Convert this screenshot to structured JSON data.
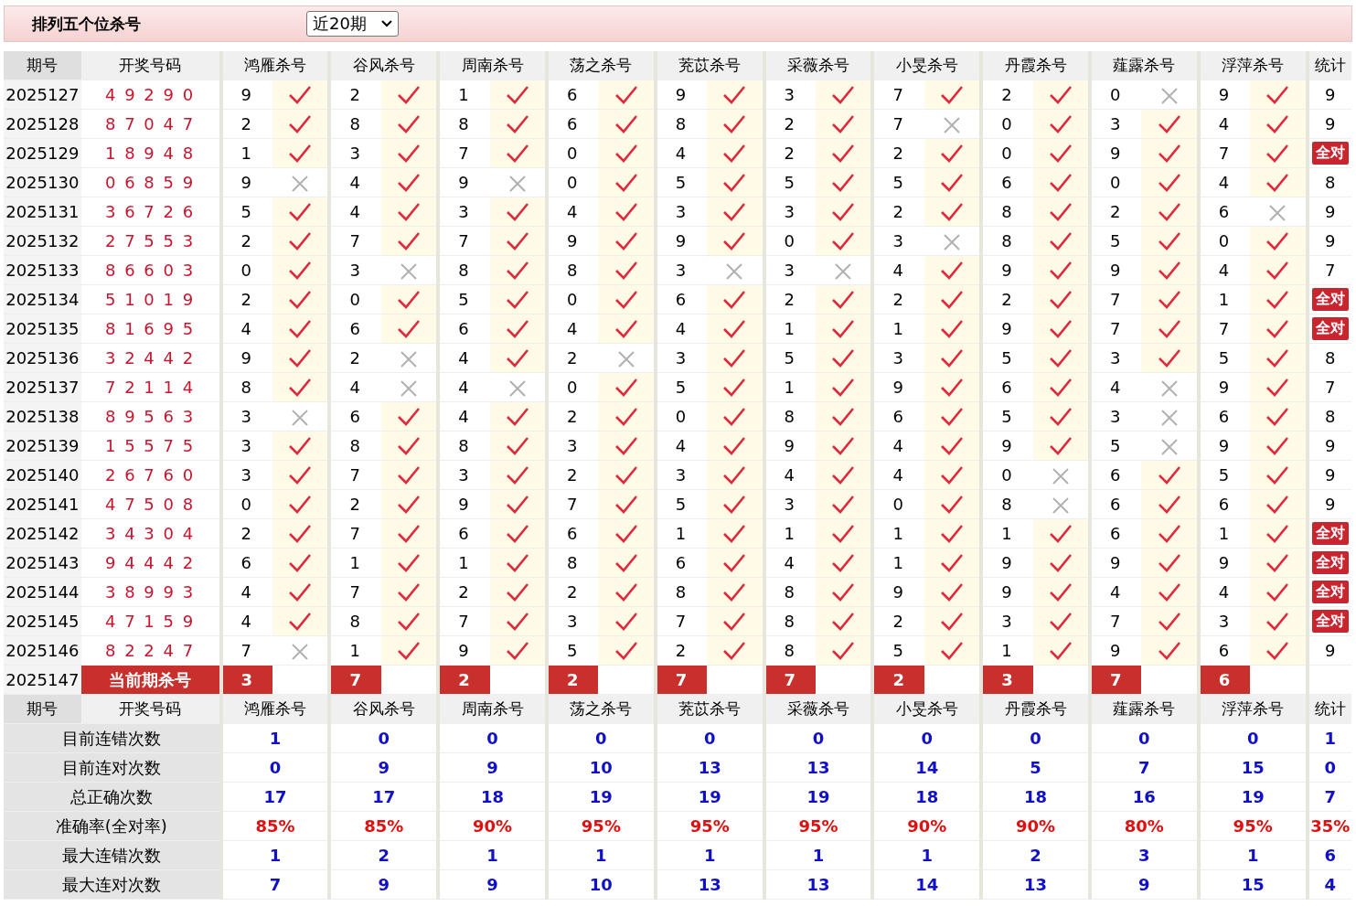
{
  "title": "排列五个位杀号",
  "period_select": {
    "value": "近20期"
  },
  "header": [
    "期号",
    "开奖号码",
    "鸿雁杀号",
    "谷风杀号",
    "周南杀号",
    "荡之杀号",
    "茺苡杀号",
    "采薇杀号",
    "小旻杀号",
    "丹霞杀号",
    "薤露杀号",
    "浮萍杀号",
    "统计"
  ],
  "rows": [
    {
      "issue": "2025127",
      "draw": "4 9 2 9 0",
      "picks": [
        {
          "n": "9",
          "hit": true
        },
        {
          "n": "2",
          "hit": true
        },
        {
          "n": "1",
          "hit": true
        },
        {
          "n": "6",
          "hit": true
        },
        {
          "n": "9",
          "hit": true
        },
        {
          "n": "3",
          "hit": true
        },
        {
          "n": "7",
          "hit": true
        },
        {
          "n": "2",
          "hit": true
        },
        {
          "n": "0",
          "hit": false
        },
        {
          "n": "9",
          "hit": true
        }
      ],
      "stat": "9",
      "all_correct": false
    },
    {
      "issue": "2025128",
      "draw": "8 7 0 4 7",
      "picks": [
        {
          "n": "2",
          "hit": true
        },
        {
          "n": "8",
          "hit": true
        },
        {
          "n": "8",
          "hit": true
        },
        {
          "n": "6",
          "hit": true
        },
        {
          "n": "8",
          "hit": true
        },
        {
          "n": "2",
          "hit": true
        },
        {
          "n": "7",
          "hit": false
        },
        {
          "n": "0",
          "hit": true
        },
        {
          "n": "3",
          "hit": true
        },
        {
          "n": "4",
          "hit": true
        }
      ],
      "stat": "9",
      "all_correct": false
    },
    {
      "issue": "2025129",
      "draw": "1 8 9 4 8",
      "picks": [
        {
          "n": "1",
          "hit": true
        },
        {
          "n": "3",
          "hit": true
        },
        {
          "n": "7",
          "hit": true
        },
        {
          "n": "0",
          "hit": true
        },
        {
          "n": "4",
          "hit": true
        },
        {
          "n": "2",
          "hit": true
        },
        {
          "n": "2",
          "hit": true
        },
        {
          "n": "0",
          "hit": true
        },
        {
          "n": "9",
          "hit": true
        },
        {
          "n": "7",
          "hit": true
        }
      ],
      "stat": "全对",
      "all_correct": true
    },
    {
      "issue": "2025130",
      "draw": "0 6 8 5 9",
      "picks": [
        {
          "n": "9",
          "hit": false
        },
        {
          "n": "4",
          "hit": true
        },
        {
          "n": "9",
          "hit": false
        },
        {
          "n": "0",
          "hit": true
        },
        {
          "n": "5",
          "hit": true
        },
        {
          "n": "5",
          "hit": true
        },
        {
          "n": "5",
          "hit": true
        },
        {
          "n": "6",
          "hit": true
        },
        {
          "n": "0",
          "hit": true
        },
        {
          "n": "4",
          "hit": true
        }
      ],
      "stat": "8",
      "all_correct": false
    },
    {
      "issue": "2025131",
      "draw": "3 6 7 2 6",
      "picks": [
        {
          "n": "5",
          "hit": true
        },
        {
          "n": "4",
          "hit": true
        },
        {
          "n": "3",
          "hit": true
        },
        {
          "n": "4",
          "hit": true
        },
        {
          "n": "3",
          "hit": true
        },
        {
          "n": "3",
          "hit": true
        },
        {
          "n": "2",
          "hit": true
        },
        {
          "n": "8",
          "hit": true
        },
        {
          "n": "2",
          "hit": true
        },
        {
          "n": "6",
          "hit": false
        }
      ],
      "stat": "9",
      "all_correct": false
    },
    {
      "issue": "2025132",
      "draw": "2 7 5 5 3",
      "picks": [
        {
          "n": "2",
          "hit": true
        },
        {
          "n": "7",
          "hit": true
        },
        {
          "n": "7",
          "hit": true
        },
        {
          "n": "9",
          "hit": true
        },
        {
          "n": "9",
          "hit": true
        },
        {
          "n": "0",
          "hit": true
        },
        {
          "n": "3",
          "hit": false
        },
        {
          "n": "8",
          "hit": true
        },
        {
          "n": "5",
          "hit": true
        },
        {
          "n": "0",
          "hit": true
        }
      ],
      "stat": "9",
      "all_correct": false
    },
    {
      "issue": "2025133",
      "draw": "8 6 6 0 3",
      "picks": [
        {
          "n": "0",
          "hit": true
        },
        {
          "n": "3",
          "hit": false
        },
        {
          "n": "8",
          "hit": true
        },
        {
          "n": "8",
          "hit": true
        },
        {
          "n": "3",
          "hit": false
        },
        {
          "n": "3",
          "hit": false
        },
        {
          "n": "4",
          "hit": true
        },
        {
          "n": "9",
          "hit": true
        },
        {
          "n": "9",
          "hit": true
        },
        {
          "n": "4",
          "hit": true
        }
      ],
      "stat": "7",
      "all_correct": false
    },
    {
      "issue": "2025134",
      "draw": "5 1 0 1 9",
      "picks": [
        {
          "n": "2",
          "hit": true
        },
        {
          "n": "0",
          "hit": true
        },
        {
          "n": "5",
          "hit": true
        },
        {
          "n": "0",
          "hit": true
        },
        {
          "n": "6",
          "hit": true
        },
        {
          "n": "2",
          "hit": true
        },
        {
          "n": "2",
          "hit": true
        },
        {
          "n": "2",
          "hit": true
        },
        {
          "n": "7",
          "hit": true
        },
        {
          "n": "1",
          "hit": true
        }
      ],
      "stat": "全对",
      "all_correct": true
    },
    {
      "issue": "2025135",
      "draw": "8 1 6 9 5",
      "picks": [
        {
          "n": "4",
          "hit": true
        },
        {
          "n": "6",
          "hit": true
        },
        {
          "n": "6",
          "hit": true
        },
        {
          "n": "4",
          "hit": true
        },
        {
          "n": "4",
          "hit": true
        },
        {
          "n": "1",
          "hit": true
        },
        {
          "n": "1",
          "hit": true
        },
        {
          "n": "9",
          "hit": true
        },
        {
          "n": "7",
          "hit": true
        },
        {
          "n": "7",
          "hit": true
        }
      ],
      "stat": "全对",
      "all_correct": true
    },
    {
      "issue": "2025136",
      "draw": "3 2 4 4 2",
      "picks": [
        {
          "n": "9",
          "hit": true
        },
        {
          "n": "2",
          "hit": false
        },
        {
          "n": "4",
          "hit": true
        },
        {
          "n": "2",
          "hit": false
        },
        {
          "n": "3",
          "hit": true
        },
        {
          "n": "5",
          "hit": true
        },
        {
          "n": "3",
          "hit": true
        },
        {
          "n": "5",
          "hit": true
        },
        {
          "n": "3",
          "hit": true
        },
        {
          "n": "5",
          "hit": true
        }
      ],
      "stat": "8",
      "all_correct": false
    },
    {
      "issue": "2025137",
      "draw": "7 2 1 1 4",
      "picks": [
        {
          "n": "8",
          "hit": true
        },
        {
          "n": "4",
          "hit": false
        },
        {
          "n": "4",
          "hit": false
        },
        {
          "n": "0",
          "hit": true
        },
        {
          "n": "5",
          "hit": true
        },
        {
          "n": "1",
          "hit": true
        },
        {
          "n": "9",
          "hit": true
        },
        {
          "n": "6",
          "hit": true
        },
        {
          "n": "4",
          "hit": false
        },
        {
          "n": "9",
          "hit": true
        }
      ],
      "stat": "7",
      "all_correct": false
    },
    {
      "issue": "2025138",
      "draw": "8 9 5 6 3",
      "picks": [
        {
          "n": "3",
          "hit": false
        },
        {
          "n": "6",
          "hit": true
        },
        {
          "n": "4",
          "hit": true
        },
        {
          "n": "2",
          "hit": true
        },
        {
          "n": "0",
          "hit": true
        },
        {
          "n": "8",
          "hit": true
        },
        {
          "n": "6",
          "hit": true
        },
        {
          "n": "5",
          "hit": true
        },
        {
          "n": "3",
          "hit": false
        },
        {
          "n": "6",
          "hit": true
        }
      ],
      "stat": "8",
      "all_correct": false
    },
    {
      "issue": "2025139",
      "draw": "1 5 5 7 5",
      "picks": [
        {
          "n": "3",
          "hit": true
        },
        {
          "n": "8",
          "hit": true
        },
        {
          "n": "8",
          "hit": true
        },
        {
          "n": "3",
          "hit": true
        },
        {
          "n": "4",
          "hit": true
        },
        {
          "n": "9",
          "hit": true
        },
        {
          "n": "4",
          "hit": true
        },
        {
          "n": "9",
          "hit": true
        },
        {
          "n": "5",
          "hit": false
        },
        {
          "n": "9",
          "hit": true
        }
      ],
      "stat": "9",
      "all_correct": false
    },
    {
      "issue": "2025140",
      "draw": "2 6 7 6 0",
      "picks": [
        {
          "n": "3",
          "hit": true
        },
        {
          "n": "7",
          "hit": true
        },
        {
          "n": "3",
          "hit": true
        },
        {
          "n": "2",
          "hit": true
        },
        {
          "n": "3",
          "hit": true
        },
        {
          "n": "4",
          "hit": true
        },
        {
          "n": "4",
          "hit": true
        },
        {
          "n": "0",
          "hit": false
        },
        {
          "n": "6",
          "hit": true
        },
        {
          "n": "5",
          "hit": true
        }
      ],
      "stat": "9",
      "all_correct": false
    },
    {
      "issue": "2025141",
      "draw": "4 7 5 0 8",
      "picks": [
        {
          "n": "0",
          "hit": true
        },
        {
          "n": "2",
          "hit": true
        },
        {
          "n": "9",
          "hit": true
        },
        {
          "n": "7",
          "hit": true
        },
        {
          "n": "5",
          "hit": true
        },
        {
          "n": "3",
          "hit": true
        },
        {
          "n": "0",
          "hit": true
        },
        {
          "n": "8",
          "hit": false
        },
        {
          "n": "6",
          "hit": true
        },
        {
          "n": "6",
          "hit": true
        }
      ],
      "stat": "9",
      "all_correct": false
    },
    {
      "issue": "2025142",
      "draw": "3 4 3 0 4",
      "picks": [
        {
          "n": "2",
          "hit": true
        },
        {
          "n": "7",
          "hit": true
        },
        {
          "n": "6",
          "hit": true
        },
        {
          "n": "6",
          "hit": true
        },
        {
          "n": "1",
          "hit": true
        },
        {
          "n": "1",
          "hit": true
        },
        {
          "n": "1",
          "hit": true
        },
        {
          "n": "1",
          "hit": true
        },
        {
          "n": "6",
          "hit": true
        },
        {
          "n": "1",
          "hit": true
        }
      ],
      "stat": "全对",
      "all_correct": true
    },
    {
      "issue": "2025143",
      "draw": "9 4 4 4 2",
      "picks": [
        {
          "n": "6",
          "hit": true
        },
        {
          "n": "1",
          "hit": true
        },
        {
          "n": "1",
          "hit": true
        },
        {
          "n": "8",
          "hit": true
        },
        {
          "n": "6",
          "hit": true
        },
        {
          "n": "4",
          "hit": true
        },
        {
          "n": "1",
          "hit": true
        },
        {
          "n": "9",
          "hit": true
        },
        {
          "n": "9",
          "hit": true
        },
        {
          "n": "9",
          "hit": true
        }
      ],
      "stat": "全对",
      "all_correct": true
    },
    {
      "issue": "2025144",
      "draw": "3 8 9 9 3",
      "picks": [
        {
          "n": "4",
          "hit": true
        },
        {
          "n": "7",
          "hit": true
        },
        {
          "n": "2",
          "hit": true
        },
        {
          "n": "2",
          "hit": true
        },
        {
          "n": "8",
          "hit": true
        },
        {
          "n": "8",
          "hit": true
        },
        {
          "n": "9",
          "hit": true
        },
        {
          "n": "9",
          "hit": true
        },
        {
          "n": "4",
          "hit": true
        },
        {
          "n": "4",
          "hit": true
        }
      ],
      "stat": "全对",
      "all_correct": true
    },
    {
      "issue": "2025145",
      "draw": "4 7 1 5 9",
      "picks": [
        {
          "n": "4",
          "hit": true
        },
        {
          "n": "8",
          "hit": true
        },
        {
          "n": "7",
          "hit": true
        },
        {
          "n": "3",
          "hit": true
        },
        {
          "n": "7",
          "hit": true
        },
        {
          "n": "8",
          "hit": true
        },
        {
          "n": "2",
          "hit": true
        },
        {
          "n": "3",
          "hit": true
        },
        {
          "n": "7",
          "hit": true
        },
        {
          "n": "3",
          "hit": true
        }
      ],
      "stat": "全对",
      "all_correct": true
    },
    {
      "issue": "2025146",
      "draw": "8 2 2 4 7",
      "picks": [
        {
          "n": "7",
          "hit": false
        },
        {
          "n": "1",
          "hit": true
        },
        {
          "n": "9",
          "hit": true
        },
        {
          "n": "5",
          "hit": true
        },
        {
          "n": "2",
          "hit": true
        },
        {
          "n": "8",
          "hit": true
        },
        {
          "n": "5",
          "hit": true
        },
        {
          "n": "1",
          "hit": true
        },
        {
          "n": "9",
          "hit": true
        },
        {
          "n": "6",
          "hit": true
        }
      ],
      "stat": "9",
      "all_correct": false
    }
  ],
  "current": {
    "issue": "2025147",
    "label": "当前期杀号",
    "picks": [
      "3",
      "7",
      "2",
      "2",
      "7",
      "7",
      "2",
      "3",
      "7",
      "6"
    ]
  },
  "footer_header": [
    "期号",
    "开奖号码",
    "鸿雁杀号",
    "谷风杀号",
    "周南杀号",
    "荡之杀号",
    "茺苡杀号",
    "采薇杀号",
    "小旻杀号",
    "丹霞杀号",
    "薤露杀号",
    "浮萍杀号",
    "统计"
  ],
  "stats": [
    {
      "label": "目前连错次数",
      "kind": "count",
      "values": [
        "1",
        "0",
        "0",
        "0",
        "0",
        "0",
        "0",
        "0",
        "0",
        "0"
      ],
      "total": "1"
    },
    {
      "label": "目前连对次数",
      "kind": "count",
      "values": [
        "0",
        "9",
        "9",
        "10",
        "13",
        "13",
        "14",
        "5",
        "7",
        "15"
      ],
      "total": "0"
    },
    {
      "label": "总正确次数",
      "kind": "count",
      "values": [
        "17",
        "17",
        "18",
        "19",
        "19",
        "19",
        "18",
        "18",
        "16",
        "19"
      ],
      "total": "7"
    },
    {
      "label": "准确率(全对率)",
      "kind": "percent",
      "values": [
        "85%",
        "85%",
        "90%",
        "95%",
        "95%",
        "95%",
        "90%",
        "90%",
        "80%",
        "95%"
      ],
      "total": "35%"
    },
    {
      "label": "最大连错次数",
      "kind": "count",
      "values": [
        "1",
        "2",
        "1",
        "1",
        "1",
        "1",
        "1",
        "2",
        "3",
        "1"
      ],
      "total": "6"
    },
    {
      "label": "最大连对次数",
      "kind": "count",
      "values": [
        "7",
        "9",
        "9",
        "10",
        "13",
        "13",
        "14",
        "13",
        "9",
        "15"
      ],
      "total": "4"
    }
  ]
}
